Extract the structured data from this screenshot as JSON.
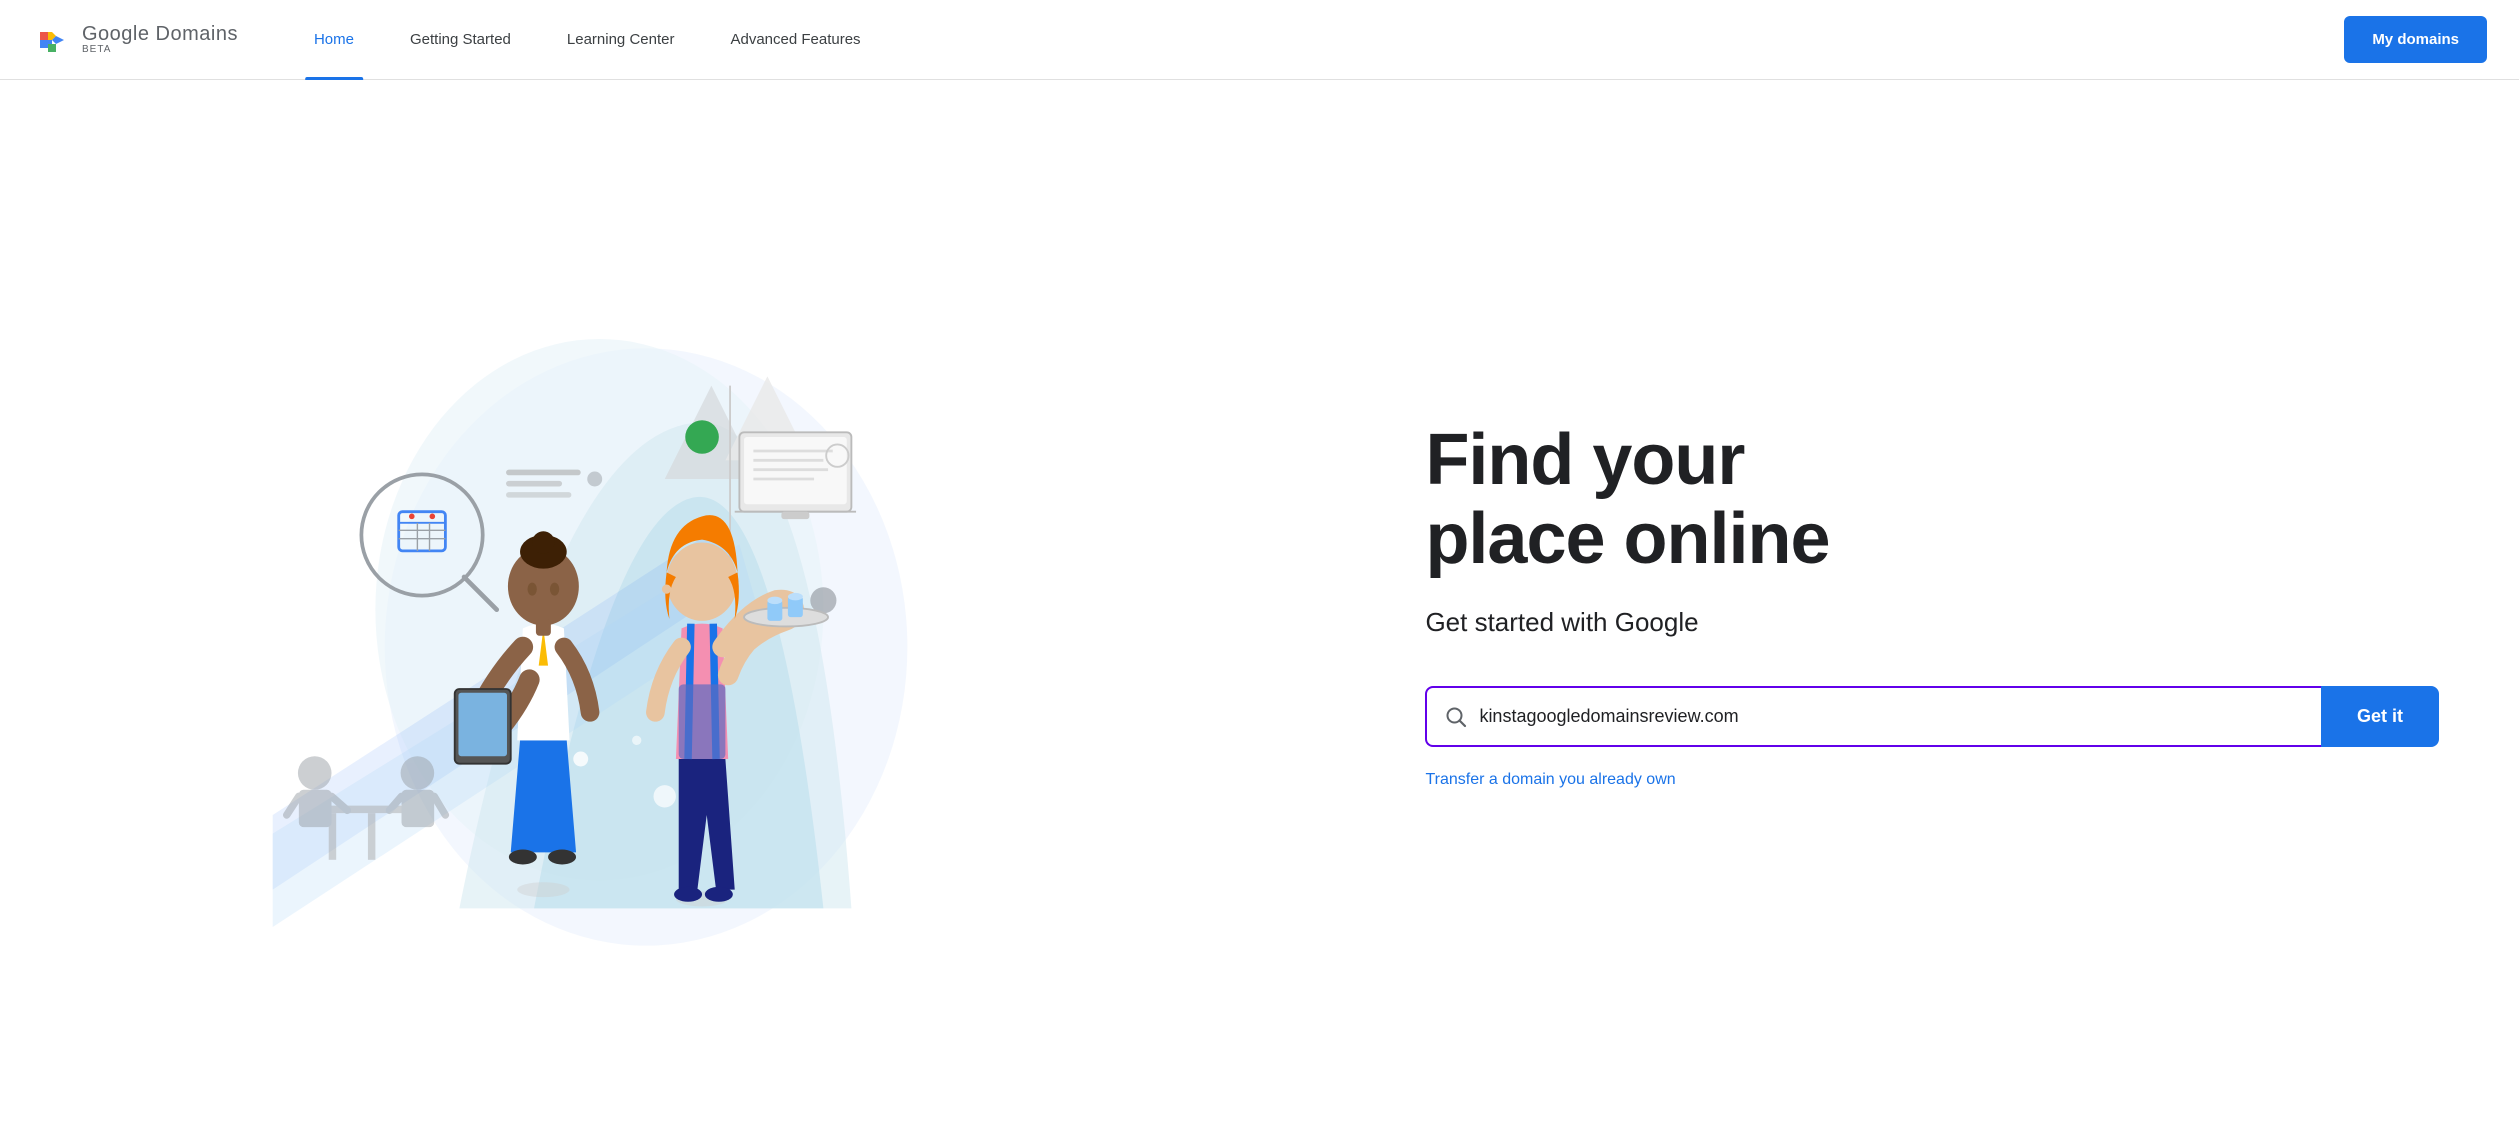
{
  "navbar": {
    "logo_name": "Google Domains",
    "logo_beta": "BETA",
    "nav_home": "Home",
    "nav_getting_started": "Getting Started",
    "nav_learning_center": "Learning Center",
    "nav_advanced_features": "Advanced Features",
    "my_domains_btn": "My domains"
  },
  "hero": {
    "title_line1": "Find your",
    "title_line2": "place online",
    "subtitle": "Get started with Google",
    "search_placeholder": "kinstagoogledomainsreview.com",
    "search_value": "kinstagoogledomainsreview.com",
    "get_it_btn": "Get it",
    "transfer_link": "Transfer a domain you already own"
  },
  "colors": {
    "brand_blue": "#1a73e8",
    "search_border": "#6200ea",
    "nav_active": "#1a73e8"
  }
}
